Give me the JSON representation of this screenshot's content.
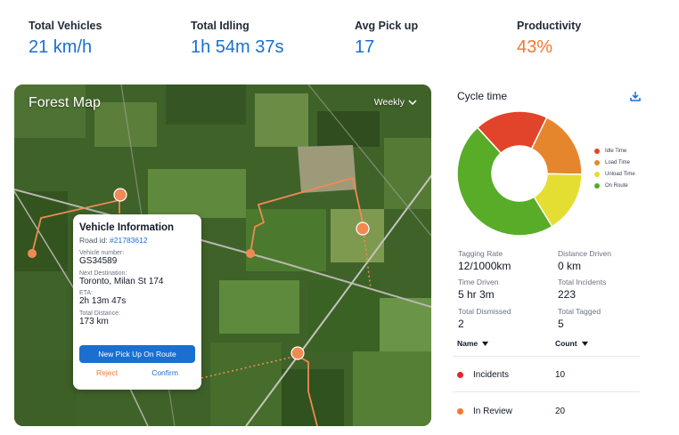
{
  "stats": [
    {
      "label": "Total Vehicles",
      "value": "21 km/h"
    },
    {
      "label": "Total Idling",
      "value": "1h 54m 37s"
    },
    {
      "label": "Avg Pick up",
      "value": "17"
    },
    {
      "label": "Productivity",
      "value": "43%"
    }
  ],
  "map": {
    "title": "Forest Map",
    "range": "Weekly"
  },
  "popup": {
    "title": "Vehicle Information",
    "road_prefix": "Road id: ",
    "road_id": "#21783612",
    "fields": [
      {
        "label": "Vehicle number:",
        "value": "GS34589"
      },
      {
        "label": "Next Destination:",
        "value": "Toronto, Milan St 174"
      },
      {
        "label": "ETA:",
        "value": "2h 13m 47s"
      },
      {
        "label": "Total Distance:",
        "value": "173 km"
      }
    ],
    "primary_button": "New Pick Up On Route",
    "reject": "Reject",
    "confirm": "Confirm"
  },
  "cycle": {
    "title": "Cycle time",
    "chart_data": {
      "type": "pie",
      "labels": [
        "Idle Time",
        "Load Time",
        "Unload Time",
        "On Route"
      ],
      "values": [
        19,
        18,
        16,
        47
      ],
      "colors": [
        "#e2432b",
        "#e6862c",
        "#e4de33",
        "#58ac28"
      ]
    }
  },
  "metrics": [
    {
      "label": "Tagging Rate",
      "value": "12/1000km"
    },
    {
      "label": "Distance Driven",
      "value": "0 km"
    },
    {
      "label": "Time Driven",
      "value": "5 hr 3m"
    },
    {
      "label": "Total Incidents",
      "value": "223"
    },
    {
      "label": "Total Dismissed",
      "value": "2"
    },
    {
      "label": "Total Tagged",
      "value": "5"
    }
  ],
  "table": {
    "headers": [
      "Name",
      "Count"
    ],
    "rows": [
      {
        "name": "Incidents",
        "count": "10",
        "color": "#e2262b"
      },
      {
        "name": "In Review",
        "count": "20",
        "color": "#f2782f"
      }
    ]
  }
}
